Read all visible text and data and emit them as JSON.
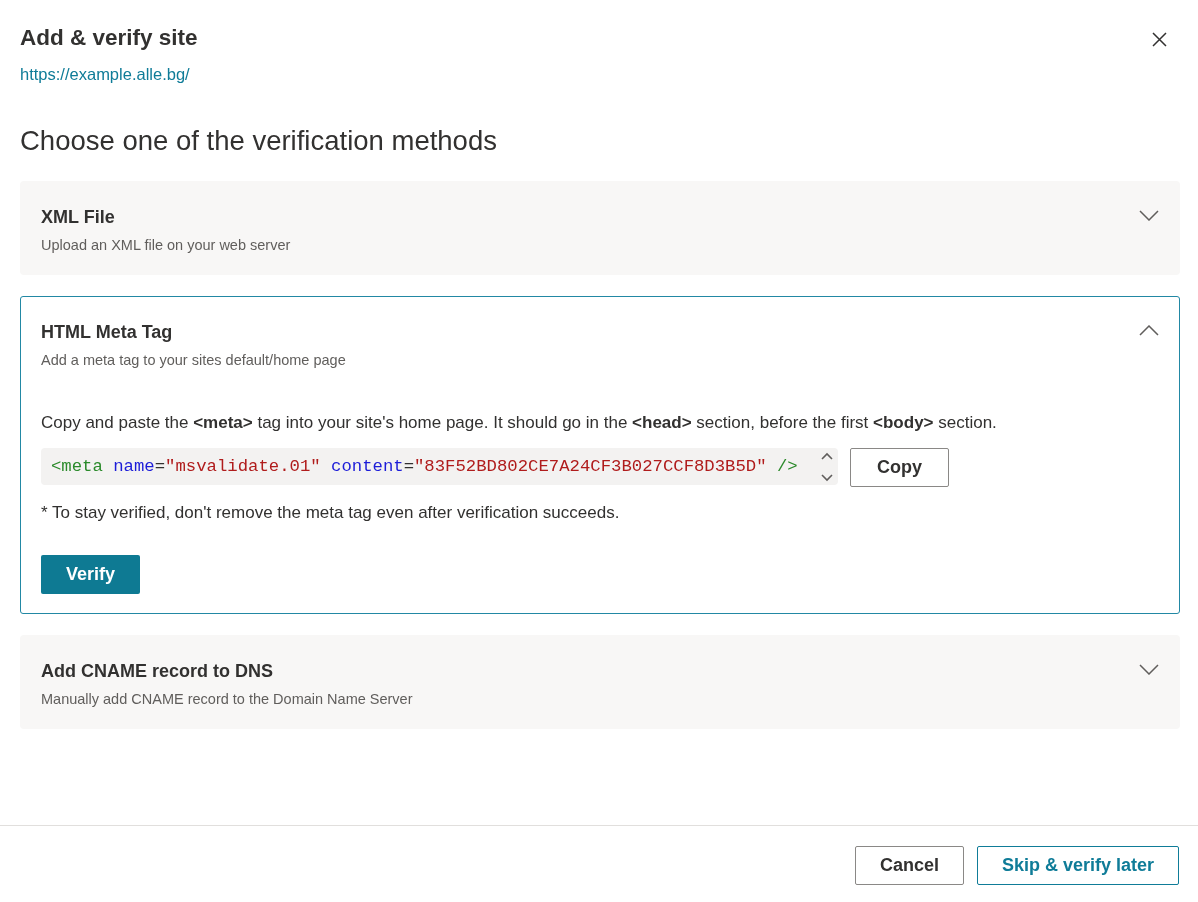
{
  "dialog": {
    "title": "Add & verify site",
    "url": "https://example.alle.bg/",
    "heading": "Choose one of the verification methods"
  },
  "methods": [
    {
      "title": "XML File",
      "description": "Upload an XML file on your web server",
      "expanded": false
    },
    {
      "title": "HTML Meta Tag",
      "description": "Add a meta tag to your sites default/home page",
      "expanded": true,
      "instructions": "Copy and paste the **<meta>** tag into your site's home page. It should go in the **<head>** section, before the first **<body>** section.",
      "code": [
        {
          "kind": "tag",
          "text": "<meta "
        },
        {
          "kind": "attr",
          "text": "name"
        },
        {
          "kind": "punct",
          "text": "="
        },
        {
          "kind": "value",
          "text": "\"msvalidate.01\" "
        },
        {
          "kind": "attr",
          "text": "content"
        },
        {
          "kind": "punct",
          "text": "="
        },
        {
          "kind": "value",
          "text": "\"83F52BD802CE7A24CF3B027CCF8D3B5D\" "
        },
        {
          "kind": "tag",
          "text": "/>"
        }
      ],
      "copy_button": "Copy",
      "note": "* To stay verified, don't remove the meta tag even after verification succeeds.",
      "verify_button": "Verify"
    },
    {
      "title": "Add CNAME record to DNS",
      "description": "Manually add CNAME record to the Domain Name Server",
      "expanded": false
    }
  ],
  "footer": {
    "buttons": [
      {
        "label": "Cancel",
        "kind": "default"
      },
      {
        "label": "Skip & verify later",
        "kind": "accent"
      }
    ]
  }
}
